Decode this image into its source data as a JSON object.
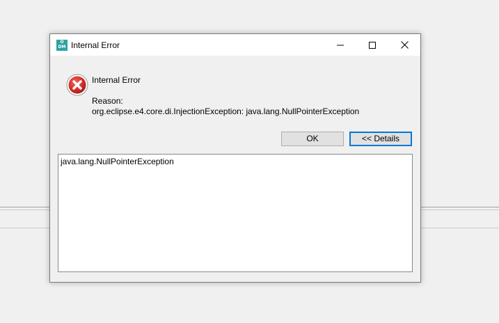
{
  "window": {
    "title": "Internal Error",
    "app_icon_text_top": "O",
    "app_icon_text_bottom": "DM"
  },
  "message": {
    "title": "Internal Error",
    "reason_label": "Reason:",
    "reason_text": "org.eclipse.e4.core.di.InjectionException: java.lang.NullPointerException"
  },
  "buttons": {
    "ok_label": "OK",
    "details_label": "<< Details"
  },
  "details": {
    "text": "java.lang.NullPointerException"
  },
  "colors": {
    "accent": "#0078d7",
    "error_red": "#c4281c",
    "app_icon": "#2ea2a2"
  },
  "icons": {
    "app": "app-icon",
    "error": "error-icon",
    "minimize": "minimize-icon",
    "maximize": "maximize-icon",
    "close": "close-icon"
  }
}
